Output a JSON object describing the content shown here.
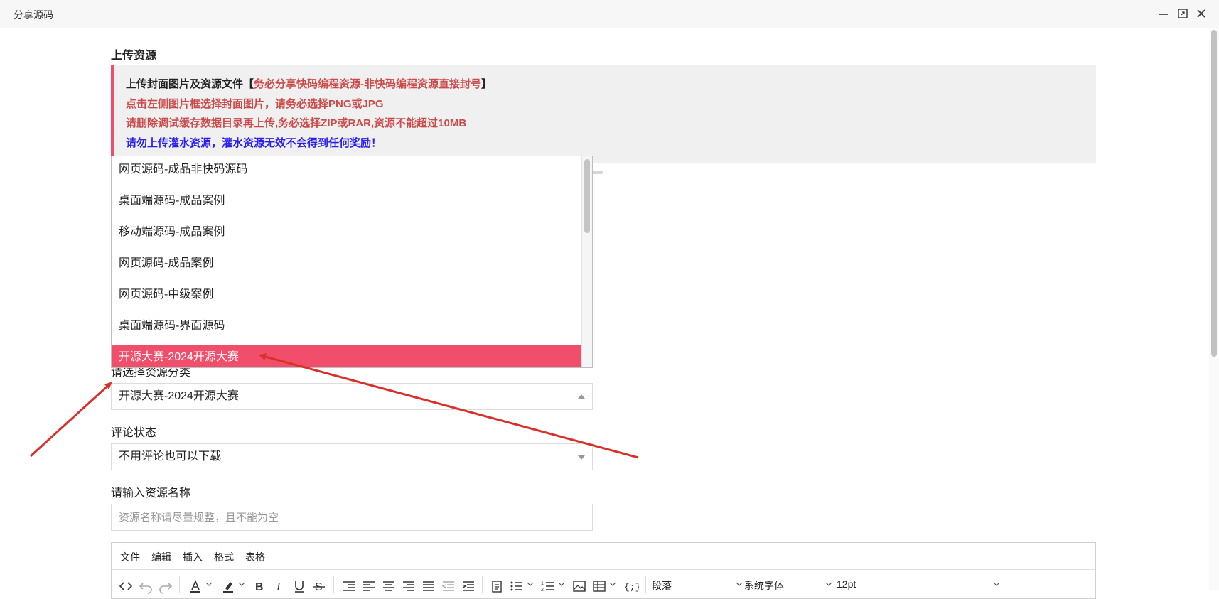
{
  "window": {
    "title": "分享源码"
  },
  "upload": {
    "section_title": "上传资源",
    "notice": {
      "line1_prefix": "上传封面图片及资源文件【",
      "line1_highlight": "务必分享快码编程资源-非快码编程资源直接封号",
      "line1_suffix": "】",
      "line2": "点击左侧图片框选择封面图片，请务必选择PNG或JPG",
      "line3": "请删除调试缓存数据目录再上传,务必选择ZIP或RAR,资源不能超过10MB",
      "line4": "请勿上传灌水资源，灌水资源无效不会得到任何奖励！"
    }
  },
  "category_dropdown": {
    "options": [
      "网页源码-成品非快码源码",
      "桌面端源码-成品案例",
      "移动端源码-成品案例",
      "网页源码-成品案例",
      "网页源码-中级案例",
      "桌面端源码-界面源码",
      "开源大赛-2024开源大赛"
    ],
    "highlighted_index": 6
  },
  "form": {
    "category_label": "请选择资源分类",
    "category_value": "开源大赛-2024开源大赛",
    "comment_label": "评论状态",
    "comment_value": "不用评论也可以下载",
    "name_label": "请输入资源名称",
    "name_placeholder": "资源名称请尽量规整，且不能为空"
  },
  "editor": {
    "menu": [
      "文件",
      "编辑",
      "插入",
      "格式",
      "表格"
    ],
    "paragraph_select": "段落",
    "font_select": "系统字体",
    "size_select": "12pt",
    "icons": [
      "code-icon",
      "undo-icon",
      "redo-icon",
      "text-color-icon",
      "highlight-icon",
      "bold-icon",
      "italic-icon",
      "underline-icon",
      "strikethrough-icon",
      "line-height-icon",
      "align-left-icon",
      "align-center-icon",
      "align-right-icon",
      "align-justify-icon",
      "outdent-icon",
      "indent-icon",
      "paste-text-icon",
      "bullet-list-icon",
      "numbered-list-icon",
      "image-icon",
      "table-icon",
      "code-sample-icon"
    ]
  },
  "colors": {
    "accent": "#f04e6a",
    "notice_red": "#cc4a4a",
    "notice_blue": "#2a1ff0",
    "annotation_arrow": "#d9302a"
  }
}
